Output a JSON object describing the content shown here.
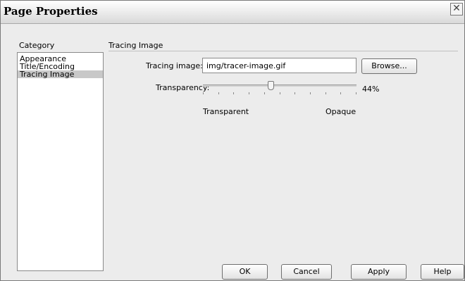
{
  "window": {
    "title": "Page Properties",
    "close_glyph": "✕"
  },
  "category": {
    "label": "Category",
    "items": [
      "Appearance",
      "Title/Encoding",
      "Tracing Image"
    ],
    "selected_index": 2
  },
  "panel": {
    "title": "Tracing Image",
    "tracing_image_label": "Tracing image:",
    "tracing_image_value": "img/tracer-image.gif",
    "browse_label": "Browse...",
    "transparency_label": "Transparency:",
    "transparency_value": 44,
    "transparency_display": "44%",
    "transparent_label": "Transparent",
    "opaque_label": "Opaque"
  },
  "buttons": {
    "ok": "OK",
    "cancel": "Cancel",
    "apply": "Apply",
    "help": "Help"
  }
}
